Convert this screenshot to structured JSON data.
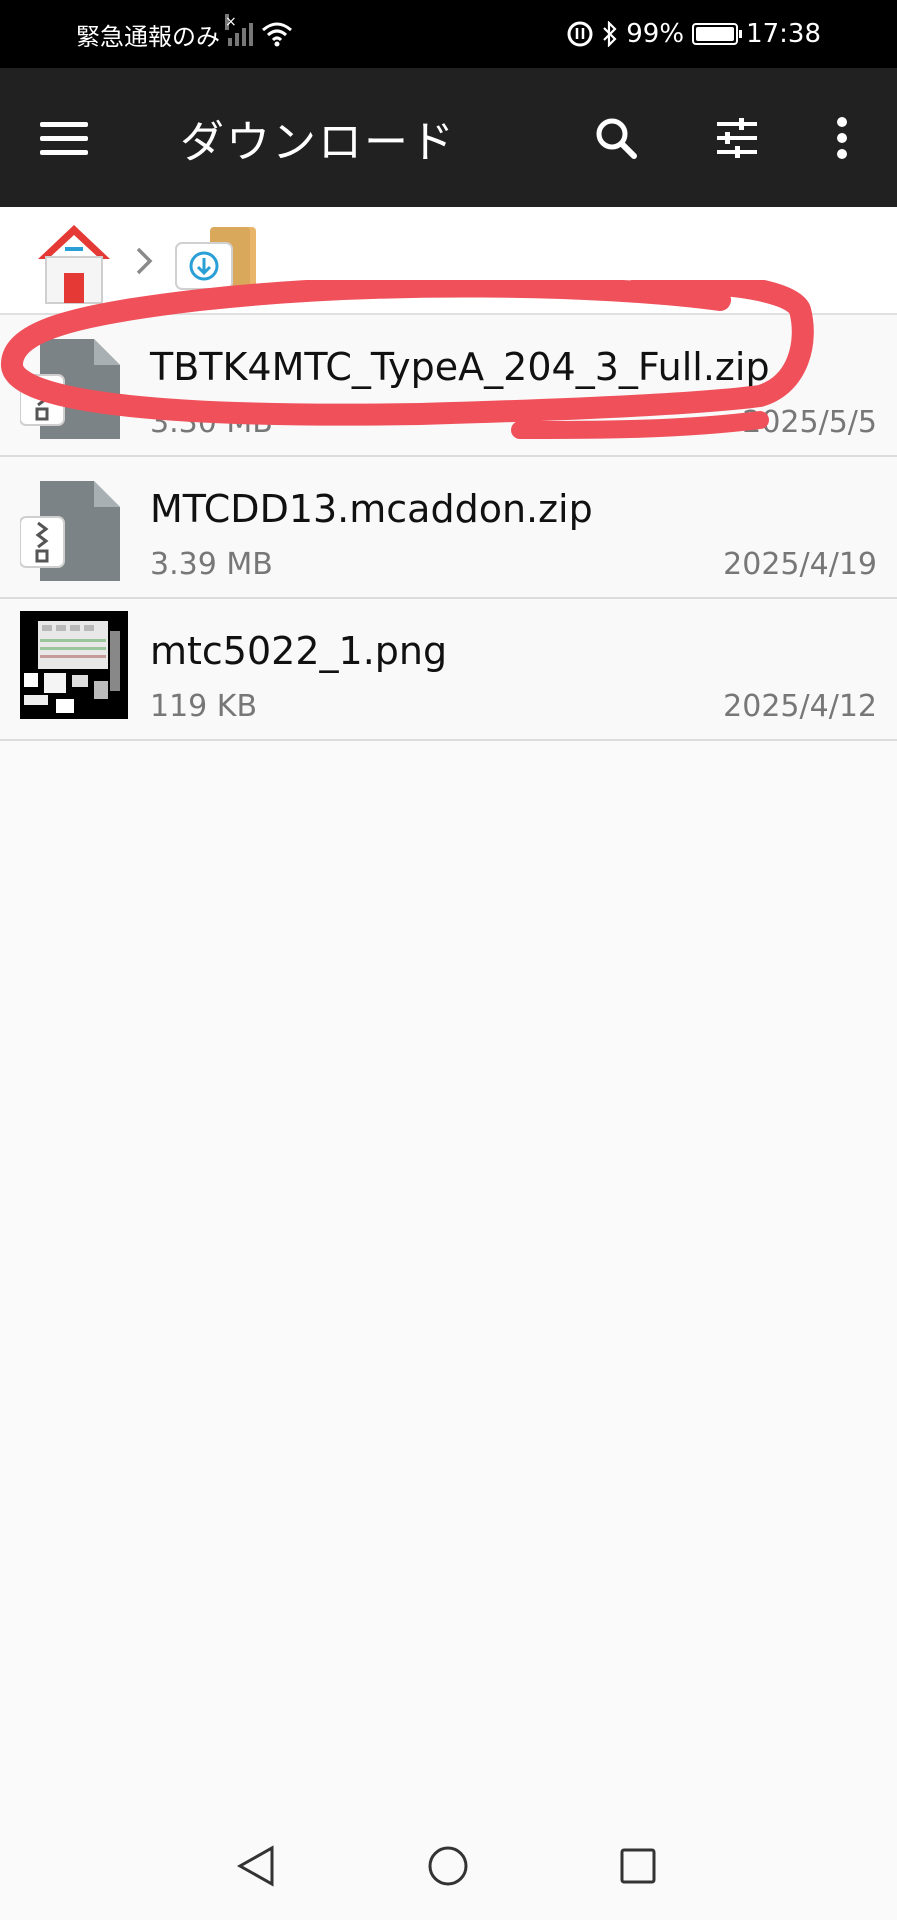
{
  "status_bar": {
    "carrier": "緊急通報のみ",
    "battery": "99%",
    "time": "17:38"
  },
  "app_bar": {
    "title": "ダウンロード"
  },
  "breadcrumb": {
    "items": [
      "home-icon",
      "download-folder-icon"
    ]
  },
  "files": [
    {
      "name": "TBTK4MTC_TypeA_204_3_Full.zip",
      "size": "3.30 MB",
      "date": "2025/5/5",
      "icon": "zip-file-icon"
    },
    {
      "name": "MTCDD13.mcaddon.zip",
      "size": "3.39 MB",
      "date": "2025/4/19",
      "icon": "zip-file-icon"
    },
    {
      "name": "mtc5022_1.png",
      "size": "119 KB",
      "date": "2025/4/12",
      "icon": "image-thumbnail"
    }
  ],
  "colors": {
    "app_bar": "#212121",
    "annotation": "#f0505a",
    "home_roof": "#e53935",
    "folder": "#d9a85b",
    "download_accent": "#2a9fd6"
  }
}
